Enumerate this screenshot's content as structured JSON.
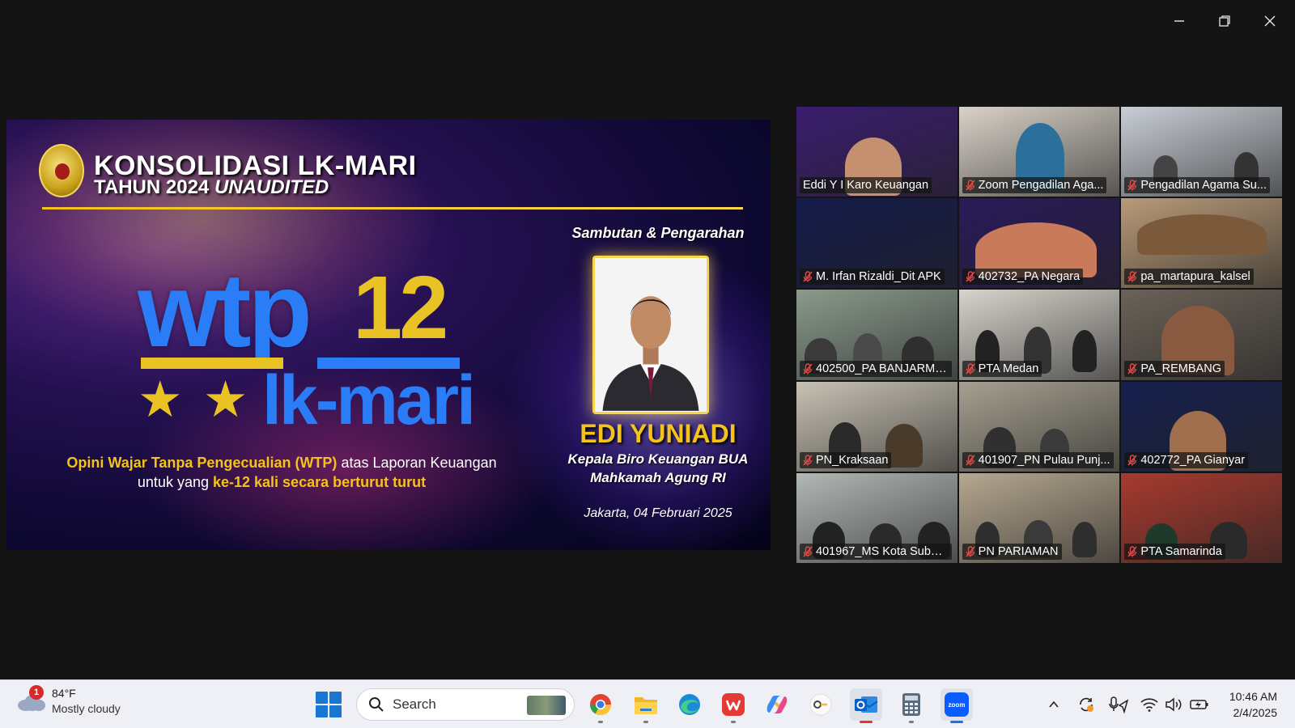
{
  "window": {
    "controls": [
      "minimize",
      "restore",
      "close"
    ]
  },
  "slide": {
    "title_line1": "KONSOLIDASI LK-MARI",
    "title_line2_prefix": "TAHUN 2024 ",
    "title_line2_italic": "UNAUDITED",
    "logo_main": "wtp",
    "logo_number": "12",
    "logo_stars": "★ ★",
    "logo_sub": "lk-mari",
    "opini_bold1": "Opini Wajar Tanpa Pengecualian (WTP)",
    "opini_text1": " atas Laporan Keuangan",
    "opini_text2": "untuk yang ",
    "opini_bold2": "ke-12 kali secara berturut turut",
    "sambutan": "Sambutan & Pengarahan",
    "speaker_name": "EDI YUNIADI",
    "speaker_title1": "Kepala Biro Keuangan BUA",
    "speaker_title2": "Mahkamah Agung RI",
    "place_date": "Jakarta, 04 Februari 2025"
  },
  "participants": [
    {
      "name": "Eddi Y I Karo Keuangan",
      "active": true,
      "muted": false,
      "bg": "#3a1d6e"
    },
    {
      "name": "Zoom Pengadilan Aga...",
      "active": false,
      "muted": true,
      "bg": "#d9d2c8"
    },
    {
      "name": "Pengadilan Agama Su...",
      "active": false,
      "muted": true,
      "bg": "#c9cfd6"
    },
    {
      "name": "M. Irfan Rizaldi_Dit APK",
      "active": false,
      "muted": true,
      "bg": "#141a4a"
    },
    {
      "name": "402732_PA Negara",
      "active": false,
      "muted": true,
      "bg": "#2a1a5a"
    },
    {
      "name": "pa_martapura_kalsel",
      "active": false,
      "muted": true,
      "bg": "#b89a78"
    },
    {
      "name": "402500_PA BANJARMA...",
      "active": false,
      "muted": true,
      "bg": "#8a9a8c"
    },
    {
      "name": "PTA Medan",
      "active": false,
      "muted": true,
      "bg": "#d8d4cc"
    },
    {
      "name": "PA_REMBANG",
      "active": false,
      "muted": true,
      "bg": "#6b6258"
    },
    {
      "name": "PN_Kraksaan",
      "active": false,
      "muted": true,
      "bg": "#c8c2b4"
    },
    {
      "name": "401907_PN Pulau Punj...",
      "active": false,
      "muted": true,
      "bg": "#a6a090"
    },
    {
      "name": "402772_PA Gianyar",
      "active": false,
      "muted": true,
      "bg": "#16204e"
    },
    {
      "name": "401967_MS Kota Subul...",
      "active": false,
      "muted": true,
      "bg": "#b2b8b6"
    },
    {
      "name": "PN PARIAMAN",
      "active": false,
      "muted": true,
      "bg": "#b6a890"
    },
    {
      "name": "PTA Samarinda",
      "active": false,
      "muted": true,
      "bg": "#a83a2e"
    }
  ],
  "taskbar": {
    "weather_badge": "1",
    "weather_temp": "84°F",
    "weather_desc": "Mostly cloudy",
    "search_placeholder": "Search",
    "apps": [
      "chrome-icon",
      "file-explorer-icon",
      "edge-icon",
      "wps-icon",
      "copilot-icon",
      "key-app-icon",
      "outlook-icon",
      "calculator-icon",
      "zoom-icon"
    ],
    "time": "10:46 AM",
    "date": "2/4/2025"
  },
  "colors": {
    "active_speaker_border": "#2fdc6a",
    "wtp_blue": "#2a7df7",
    "gold": "#e9c224"
  }
}
